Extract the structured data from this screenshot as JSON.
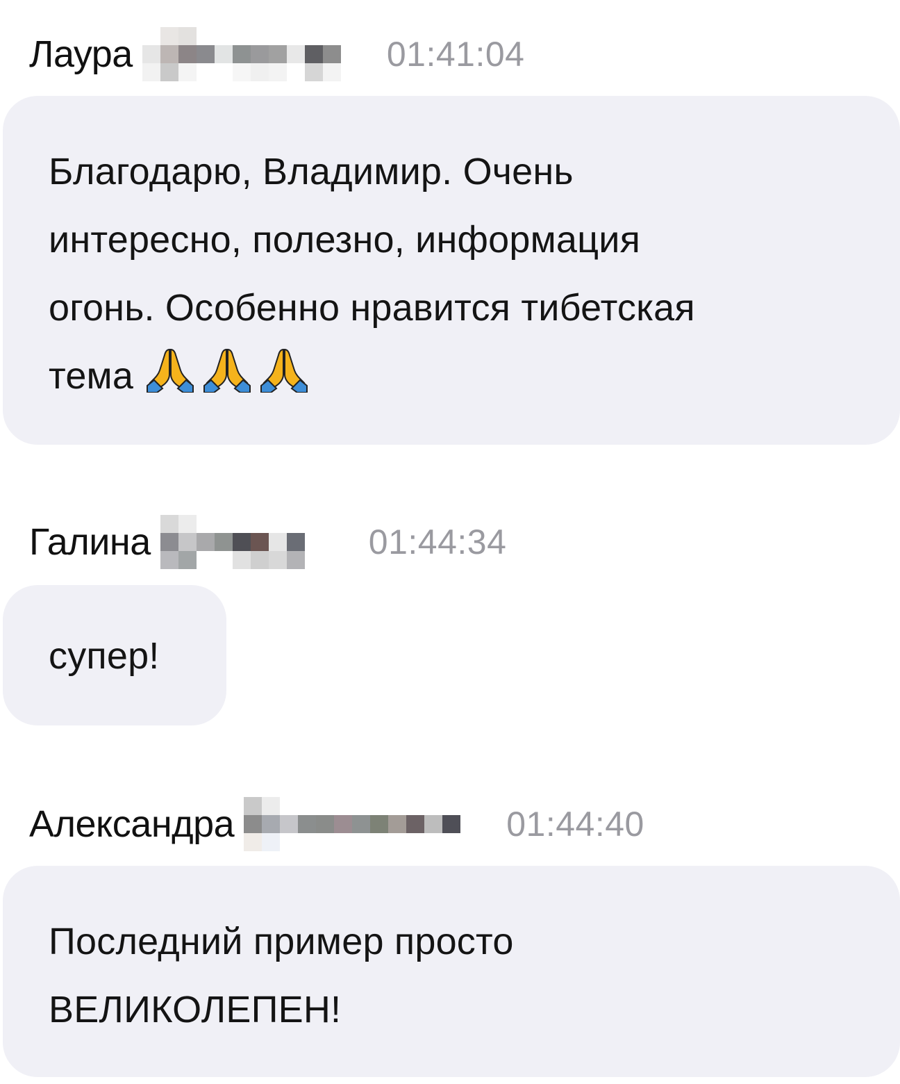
{
  "messages": [
    {
      "author": "Лаура",
      "time": "01:41:04",
      "text_lines": [
        "Благодарю, Владимир. Очень",
        "интересно, полезно, информация",
        "огонь. Особенно нравится тибетская",
        "тема"
      ],
      "icons": [
        "folded-hands-icon",
        "folded-hands-icon",
        "folded-hands-icon"
      ]
    },
    {
      "author": "Галина",
      "time": "01:44:34",
      "text_lines": [
        "супер!"
      ]
    },
    {
      "author": "Александра",
      "time": "01:44:40",
      "text_lines": [
        "Последний пример просто",
        "ВЕЛИКОЛЕПЕН!"
      ]
    }
  ],
  "colors": {
    "bubble_bg": "#f0f0f6",
    "time_text": "#9a9aa0",
    "author_text": "#111111",
    "message_text": "#141414",
    "emoji_skin": "#f5b31c",
    "emoji_sleeve": "#3e8ed8"
  }
}
